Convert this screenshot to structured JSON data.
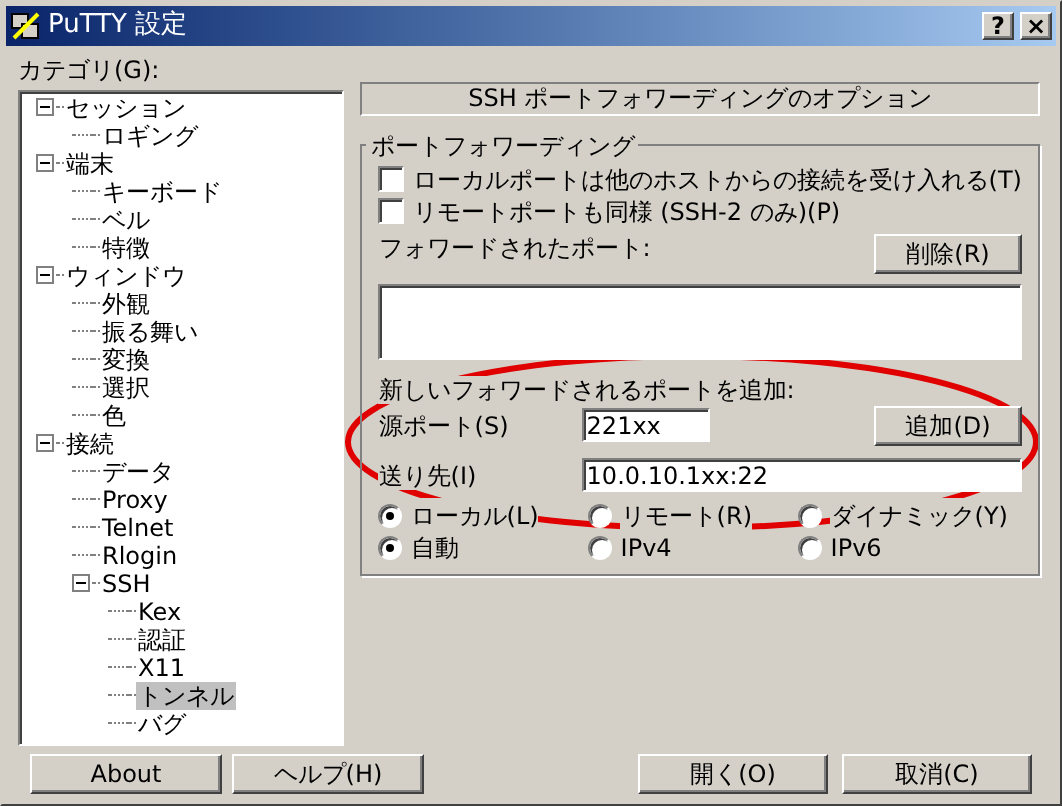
{
  "window": {
    "title": "PuTTY 設定",
    "buttons": [
      "?",
      "×"
    ]
  },
  "category_label": "カテゴリ(G):",
  "tree": [
    {
      "label": "セッション",
      "expanded": true,
      "selected": false,
      "children": [
        {
          "label": "ロギング",
          "selected": false
        }
      ]
    },
    {
      "label": "端末",
      "expanded": true,
      "selected": false,
      "children": [
        {
          "label": "キーボード",
          "selected": false
        },
        {
          "label": "ベル",
          "selected": false
        },
        {
          "label": "特徴",
          "selected": false
        }
      ]
    },
    {
      "label": "ウィンドウ",
      "expanded": true,
      "selected": false,
      "children": [
        {
          "label": "外観",
          "selected": false
        },
        {
          "label": "振る舞い",
          "selected": false
        },
        {
          "label": "変換",
          "selected": false
        },
        {
          "label": "選択",
          "selected": false
        },
        {
          "label": "色",
          "selected": false
        }
      ]
    },
    {
      "label": "接続",
      "expanded": true,
      "selected": false,
      "children": [
        {
          "label": "データ",
          "selected": false
        },
        {
          "label": "Proxy",
          "selected": false
        },
        {
          "label": "Telnet",
          "selected": false
        },
        {
          "label": "Rlogin",
          "selected": false
        },
        {
          "label": "SSH",
          "expanded": true,
          "selected": false,
          "children": [
            {
              "label": "Kex",
              "selected": false
            },
            {
              "label": "認証",
              "selected": false
            },
            {
              "label": "X11",
              "selected": false
            },
            {
              "label": "トンネル",
              "selected": true
            },
            {
              "label": "バグ",
              "selected": false
            }
          ]
        }
      ]
    }
  ],
  "panel": {
    "header": "SSH ポートフォワーディングのオプション",
    "group_title": "ポートフォワーディング",
    "checkboxes": [
      {
        "label": "ローカルポートは他のホストからの接続を受け入れる(T)",
        "checked": false
      },
      {
        "label": "リモートポートも同様 (SSH-2 のみ)(P)",
        "checked": false
      }
    ],
    "forwarded_label": "フォワードされたポート:",
    "remove_button": "削除(R)",
    "add_label": "新しいフォワードされるポートを追加:",
    "source_port": {
      "label": "源ポート(S)",
      "value": "221xx"
    },
    "add_button": "追加(D)",
    "destination": {
      "label": "送り先(I)",
      "value": "10.0.10.1xx:22"
    },
    "radio_rows": [
      [
        {
          "label": "ローカル(L)",
          "selected": true
        },
        {
          "label": "リモート(R)",
          "selected": false
        },
        {
          "label": "ダイナミック(Y)",
          "selected": false
        }
      ],
      [
        {
          "label": "自動",
          "selected": true
        },
        {
          "label": "IPv4",
          "selected": false
        },
        {
          "label": "IPv6",
          "selected": false
        }
      ]
    ]
  },
  "footer_buttons": {
    "left": [
      "About",
      "ヘルプ(H)"
    ],
    "right": [
      "開く(O)",
      "取消(C)"
    ]
  }
}
